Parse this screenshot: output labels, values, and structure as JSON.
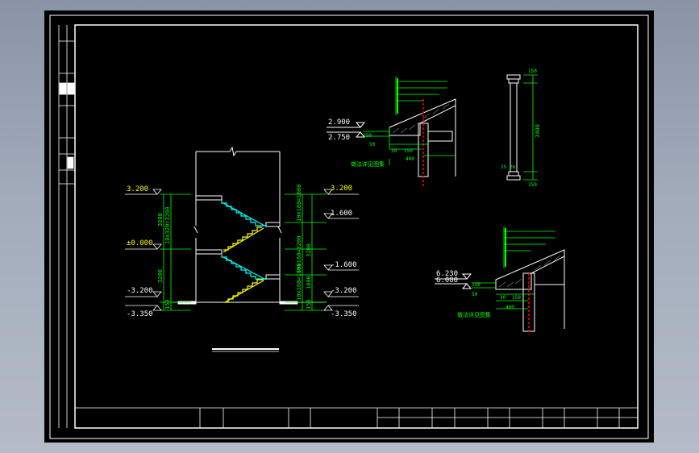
{
  "colors": {
    "background": "#000000",
    "border": "#ffffff",
    "dimension": "#00ff00",
    "level_text": "#ffff00",
    "stair_cyan": "#00ffff",
    "stair_yellow": "#ffff00",
    "wall_red": "#ff0000",
    "leader_green": "#00ff00"
  },
  "stair_section": {
    "left_levels": [
      "3.200",
      "±0.000",
      "-3.200",
      "-3.350"
    ],
    "right_levels": [
      "3.200",
      "1.600",
      "-1.600",
      "-3.200",
      "-3.350"
    ],
    "left_dims": [
      "3200",
      "10x320=3200",
      "3200",
      "150"
    ],
    "right_dims": [
      "10x160=1600",
      "10x160=3200",
      "10x160=1600",
      "3200",
      "1600",
      "150"
    ]
  },
  "detail_upper": {
    "levels": [
      "2.900",
      "2.750"
    ],
    "dims": [
      "150",
      "50",
      "30",
      "150",
      "400"
    ],
    "note": "做法详见图集"
  },
  "detail_lower": {
    "levels": [
      "6.230",
      "6.080"
    ],
    "dims": [
      "150",
      "50",
      "30",
      "150",
      "400"
    ],
    "note": "做法详见图集"
  },
  "column_detail": {
    "dims": [
      "3400",
      "150",
      "150"
    ],
    "label": "15 26"
  }
}
